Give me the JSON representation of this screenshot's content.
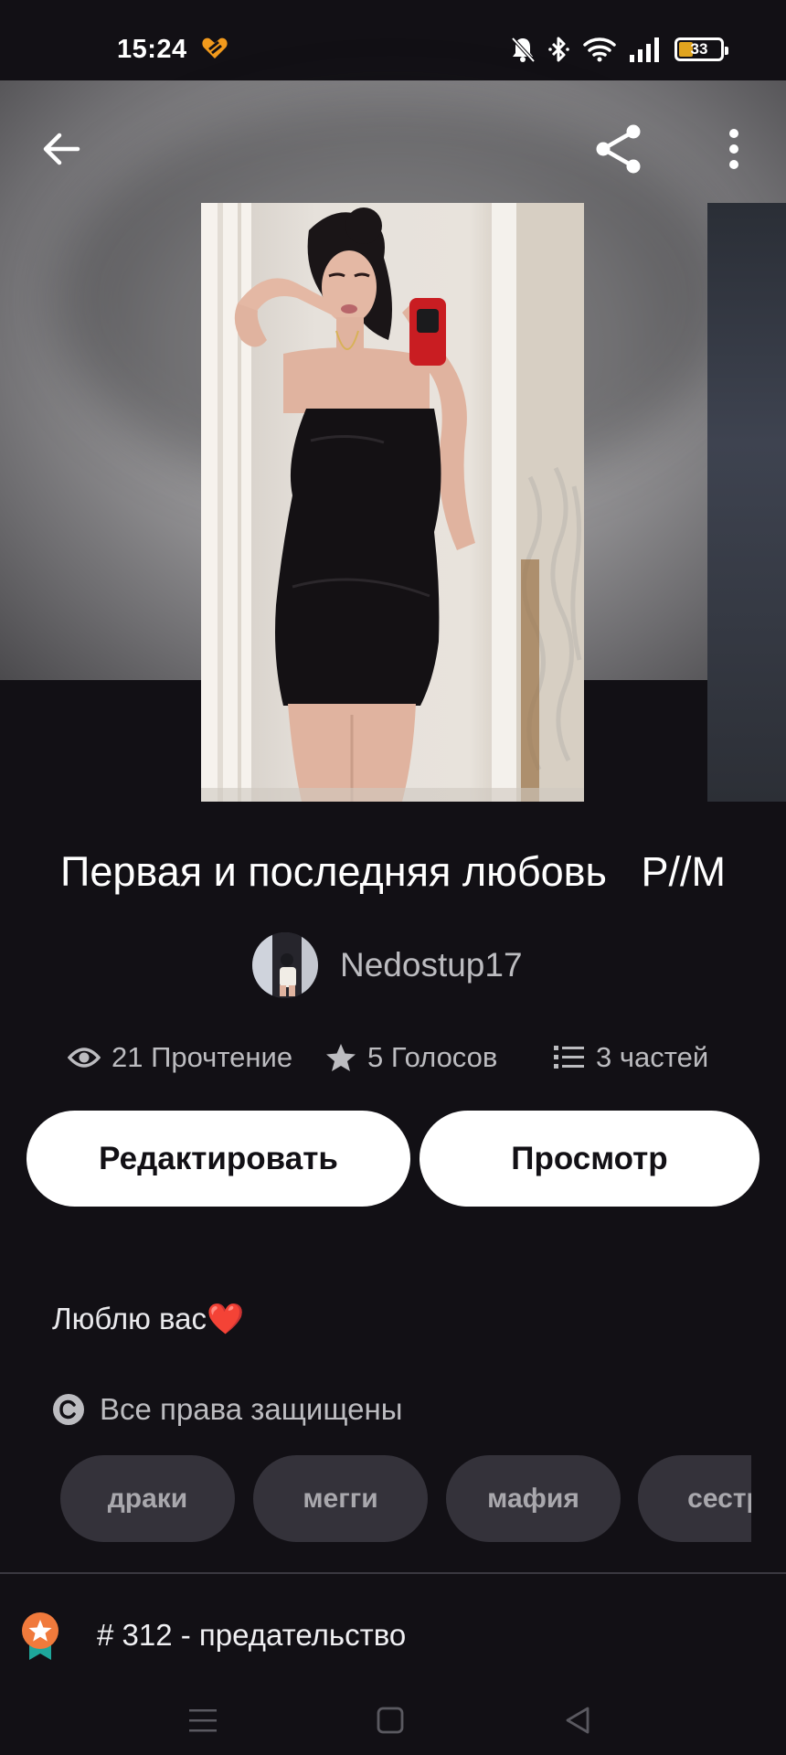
{
  "status_bar": {
    "time": "15:24",
    "battery": "33",
    "battery_level": 0.33
  },
  "hero": {
    "icons": [
      "back-arrow-icon",
      "share-icon",
      "more-vertical-icon"
    ]
  },
  "story": {
    "title": "Первая и последняя любовь   Р//М",
    "author": "Nedostup17",
    "stats": {
      "reads": "21 Прочтение",
      "votes": "5 Голосов",
      "parts": "3 частей"
    },
    "buttons": {
      "edit": "Редактировать",
      "preview": "Просмотр"
    },
    "description": "Люблю вас",
    "description_emoji": "❤️",
    "copyright": "Все права защищены",
    "tags": [
      "драки",
      "мегги",
      "мафия",
      "сестр"
    ],
    "rank": "# 312 - предательство"
  },
  "colors": {
    "background": "#121015",
    "tag_background": "#34323a",
    "button_background": "#ffffff",
    "rank_badge": "#f07a3c",
    "battery_fill": "#e0a41f"
  }
}
